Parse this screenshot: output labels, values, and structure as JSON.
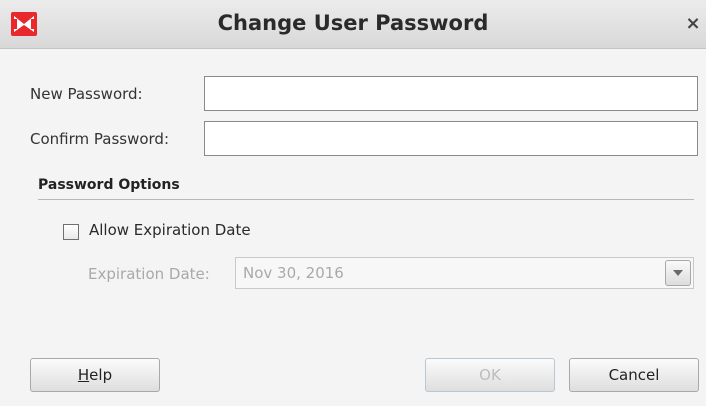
{
  "window": {
    "title": "Change User Password",
    "close_glyph": "×",
    "app_icon": "oracle-logo-icon",
    "app_icon_color": "#e8282b"
  },
  "form": {
    "new_password": {
      "label": "New Password:",
      "value": ""
    },
    "confirm_password": {
      "label": "Confirm Password:",
      "value": ""
    }
  },
  "password_options": {
    "section_title": "Password Options",
    "allow_expiration": {
      "label": "Allow Expiration Date",
      "checked": false
    },
    "expiration_date": {
      "label": "Expiration Date:",
      "value": "Nov 30, 2016",
      "enabled": false
    }
  },
  "buttons": {
    "help": {
      "mnemonic": "H",
      "rest": "elp"
    },
    "ok": "OK",
    "cancel": "Cancel"
  }
}
